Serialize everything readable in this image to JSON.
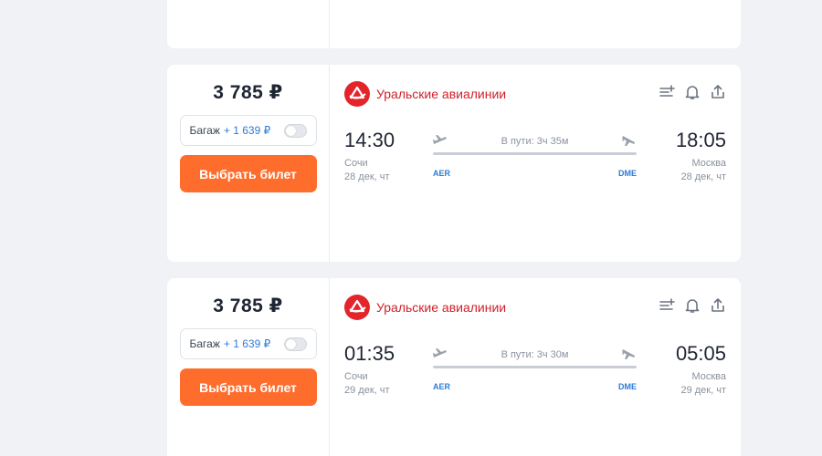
{
  "colors": {
    "accent_button": "#ff6d2d",
    "airline_red": "#e3242b",
    "link_blue": "#2e7bd6"
  },
  "flights": [
    {
      "price": "3 785 ₽",
      "baggage_label": "Багаж",
      "baggage_price": "+ 1 639 ₽",
      "buy_label": "Выбрать билет",
      "airline": "Уральские авиалинии",
      "dep_time": "14:30",
      "arr_time": "18:05",
      "duration": "В пути: 3ч 35м",
      "dep_city": "Сочи",
      "arr_city": "Москва",
      "dep_date": "28 дек, чт",
      "arr_date": "28 дек, чт",
      "dep_iata": "AER",
      "arr_iata": "DME"
    },
    {
      "price": "3 785 ₽",
      "baggage_label": "Багаж",
      "baggage_price": "+ 1 639 ₽",
      "buy_label": "Выбрать билет",
      "airline": "Уральские авиалинии",
      "dep_time": "01:35",
      "arr_time": "05:05",
      "duration": "В пути: 3ч 30м",
      "dep_city": "Сочи",
      "arr_city": "Москва",
      "dep_date": "29 дек, чт",
      "arr_date": "29 дек, чт",
      "dep_iata": "AER",
      "arr_iata": "DME"
    }
  ]
}
